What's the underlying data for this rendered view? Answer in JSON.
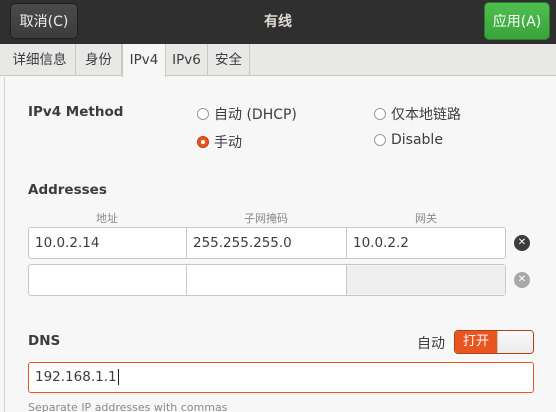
{
  "header": {
    "cancel_label": "取消(C)",
    "title": "有线",
    "apply_label": "应用(A)"
  },
  "tabs": [
    {
      "label": "详细信息"
    },
    {
      "label": "身份"
    },
    {
      "label": "IPv4",
      "active": true
    },
    {
      "label": "IPv6"
    },
    {
      "label": "安全"
    }
  ],
  "ipv4_method": {
    "label": "IPv4 Method",
    "options": [
      {
        "label": "自动 (DHCP)",
        "selected": false
      },
      {
        "label": "仅本地链路",
        "selected": false
      },
      {
        "label": "手动",
        "selected": true
      },
      {
        "label": "Disable",
        "selected": false
      }
    ]
  },
  "addresses": {
    "label": "Addresses",
    "columns": [
      "地址",
      "子网掩码",
      "网关"
    ],
    "rows": [
      [
        "10.0.2.14",
        "255.255.255.0",
        "10.0.2.2"
      ],
      [
        "",
        "",
        ""
      ]
    ]
  },
  "dns": {
    "label": "DNS",
    "auto_label": "自动",
    "toggle_label": "打开",
    "toggle_on": true,
    "value": "192.168.1.1",
    "hint": "Separate IP addresses with commas"
  },
  "colors": {
    "accent": "#e95420",
    "apply_green": "#3aa33a",
    "header_bg": "#2f2f2f"
  }
}
